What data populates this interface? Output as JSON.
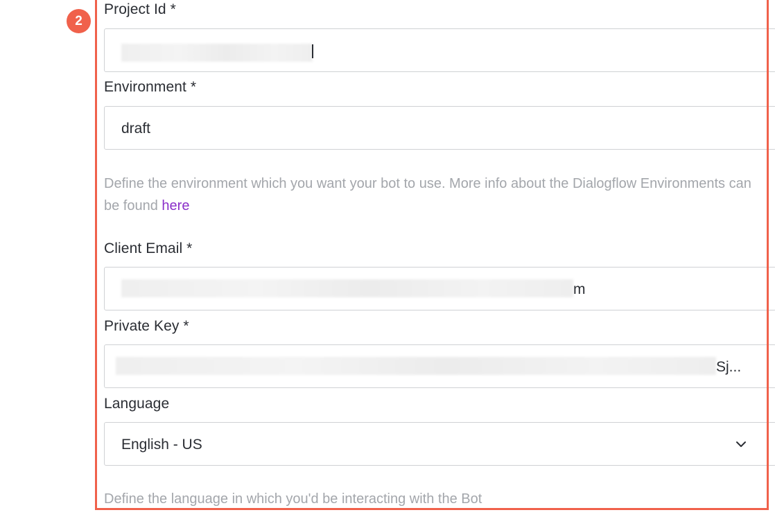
{
  "step_badge": "2",
  "form": {
    "project_id": {
      "label": "Project Id *",
      "value": ""
    },
    "environment": {
      "label": "Environment *",
      "value": "draft",
      "help_text": "Define the environment which you want your bot to use. More info about the Dialogflow Environments can be found ",
      "help_link": "here"
    },
    "client_email": {
      "label": "Client Email *",
      "visible_tail": "m"
    },
    "private_key": {
      "label": "Private Key *",
      "visible_tail": "Sj..."
    },
    "language": {
      "label": "Language",
      "selected": "English - US",
      "help_text": "Define the language in which you'd be interacting with the Bot"
    }
  },
  "icons": {
    "dropdown": "chevron-down-icon"
  },
  "colors": {
    "highlight": "#f0614b",
    "link": "#8b2fc9",
    "help_text": "#a3a6ab",
    "text": "#2a2d33",
    "border": "#cfd1d4"
  }
}
